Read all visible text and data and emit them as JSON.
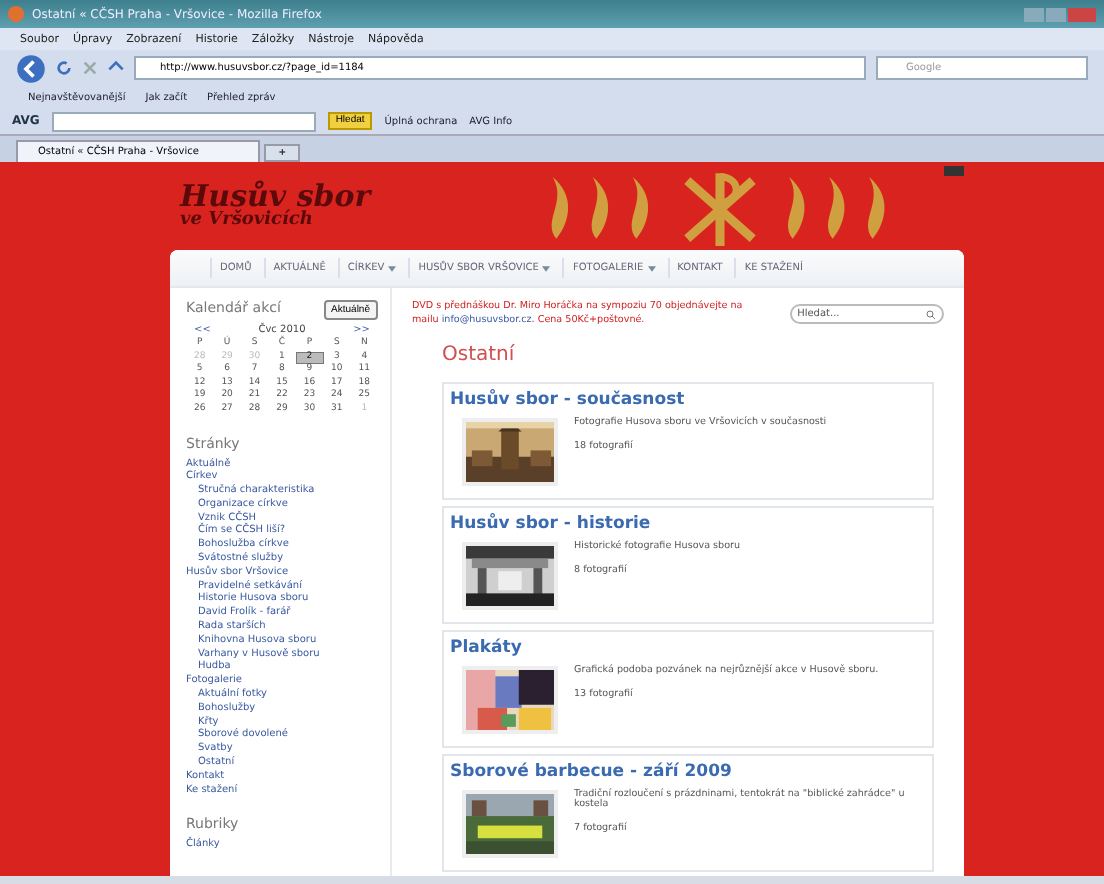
{
  "window": {
    "title": "Ostatní « CČSH Praha - Vršovice - Mozilla Firefox"
  },
  "menu": [
    "Soubor",
    "Úpravy",
    "Zobrazení",
    "Historie",
    "Záložky",
    "Nástroje",
    "Nápověda"
  ],
  "address": {
    "value": "http://www.husuvsbor.cz/?page_id=1184"
  },
  "browser_search": {
    "placeholder": "Google"
  },
  "bookmarks": [
    "Nejnavštěvovanější",
    "Jak začít",
    "Přehled zpráv"
  ],
  "avg_toolbar": {
    "logo": "AVG",
    "search_button": "Hledat",
    "items": [
      "Úplná ochrana",
      "AVG Info"
    ]
  },
  "tabs": [
    {
      "label": "Ostatní « CČSH Praha - Vršovice",
      "selected": true
    }
  ],
  "new_tab": "+",
  "site": {
    "title": "Husův sbor",
    "subtitle": "ve Vršovicích"
  },
  "nav": [
    {
      "label": "DOMŮ",
      "dropdown": false
    },
    {
      "label": "AKTUÁLNĚ",
      "dropdown": false
    },
    {
      "label": "CÍRKEV",
      "dropdown": true
    },
    {
      "label": "HUSŮV SBOR VRŠOVICE",
      "dropdown": true
    },
    {
      "label": "FOTOGALERIE",
      "dropdown": true
    },
    {
      "label": "KONTAKT",
      "dropdown": false
    },
    {
      "label": "KE STAŽENÍ",
      "dropdown": false
    }
  ],
  "calendar": {
    "title": "Kalendář akcí",
    "today_button": "Aktuálně",
    "prev": "<<",
    "month": "Čvc 2010",
    "next": ">>",
    "weekdays": [
      "P",
      "Ú",
      "S",
      "Č",
      "P",
      "S",
      "N"
    ],
    "weeks": [
      [
        {
          "day": "28",
          "other_month": true,
          "selected": false
        },
        {
          "day": "29",
          "other_month": true,
          "selected": false
        },
        {
          "day": "30",
          "other_month": true,
          "selected": false
        },
        {
          "day": "1",
          "other_month": false,
          "selected": false
        },
        {
          "day": "2",
          "other_month": false,
          "selected": true
        },
        {
          "day": "3",
          "other_month": false,
          "selected": false
        },
        {
          "day": "4",
          "other_month": false,
          "selected": false
        }
      ],
      [
        {
          "day": "5",
          "other_month": false,
          "selected": false
        },
        {
          "day": "6",
          "other_month": false,
          "selected": false
        },
        {
          "day": "7",
          "other_month": false,
          "selected": false
        },
        {
          "day": "8",
          "other_month": false,
          "selected": false
        },
        {
          "day": "9",
          "other_month": false,
          "selected": false
        },
        {
          "day": "10",
          "other_month": false,
          "selected": false
        },
        {
          "day": "11",
          "other_month": false,
          "selected": false
        }
      ],
      [
        {
          "day": "12",
          "other_month": false,
          "selected": false
        },
        {
          "day": "13",
          "other_month": false,
          "selected": false
        },
        {
          "day": "14",
          "other_month": false,
          "selected": false
        },
        {
          "day": "15",
          "other_month": false,
          "selected": false
        },
        {
          "day": "16",
          "other_month": false,
          "selected": false
        },
        {
          "day": "17",
          "other_month": false,
          "selected": false
        },
        {
          "day": "18",
          "other_month": false,
          "selected": false
        }
      ],
      [
        {
          "day": "19",
          "other_month": false,
          "selected": false
        },
        {
          "day": "20",
          "other_month": false,
          "selected": false
        },
        {
          "day": "21",
          "other_month": false,
          "selected": false
        },
        {
          "day": "22",
          "other_month": false,
          "selected": false
        },
        {
          "day": "23",
          "other_month": false,
          "selected": false
        },
        {
          "day": "24",
          "other_month": false,
          "selected": false
        },
        {
          "day": "25",
          "other_month": false,
          "selected": false
        }
      ],
      [
        {
          "day": "26",
          "other_month": false,
          "selected": false
        },
        {
          "day": "27",
          "other_month": false,
          "selected": false
        },
        {
          "day": "28",
          "other_month": false,
          "selected": false
        },
        {
          "day": "29",
          "other_month": false,
          "selected": false
        },
        {
          "day": "30",
          "other_month": false,
          "selected": false
        },
        {
          "day": "31",
          "other_month": false,
          "selected": false
        },
        {
          "day": "1",
          "other_month": true,
          "selected": false
        }
      ]
    ]
  },
  "pages": {
    "title": "Stránky",
    "items": [
      {
        "label": "Aktuálně"
      },
      {
        "label": "Církev",
        "children": [
          {
            "label": "Stručná charakteristika"
          },
          {
            "label": "Organizace církve"
          },
          {
            "label": "Vznik CČSH"
          },
          {
            "label": "Čím se CČSH liší?"
          },
          {
            "label": "Bohoslužba církve"
          },
          {
            "label": "Svátostné služby"
          }
        ]
      },
      {
        "label": "Husův sbor Vršovice",
        "children": [
          {
            "label": "Pravidelné setkávání"
          },
          {
            "label": "Historie Husova sboru"
          },
          {
            "label": "David Frolík - farář"
          },
          {
            "label": "Rada starších"
          },
          {
            "label": "Knihovna Husova sboru"
          },
          {
            "label": "Varhany v Husově sboru"
          },
          {
            "label": "Hudba"
          }
        ]
      },
      {
        "label": "Fotogalerie",
        "children": [
          {
            "label": "Aktuální fotky"
          },
          {
            "label": "Bohoslužby"
          },
          {
            "label": "Křty"
          },
          {
            "label": "Sborové dovolené"
          },
          {
            "label": "Svatby"
          },
          {
            "label": "Ostatní"
          }
        ]
      },
      {
        "label": "Kontakt"
      },
      {
        "label": "Ke stažení"
      }
    ]
  },
  "categories": {
    "title": "Rubriky",
    "items": [
      "Články"
    ]
  },
  "notice": {
    "text": "DVD s přednáškou Dr. Miro Horáčka na sympoziu 70 objednávejte na mailu",
    "link": "info@husuvsbor.cz",
    "after": ". Cena 50Kč+poštovné."
  },
  "search": {
    "placeholder": "Hledat..."
  },
  "page_title": "Ostatní",
  "galleries": [
    {
      "title": "Husův sbor - současnost",
      "description": "Fotografie Husova sboru ve Vršovicích v současnosti",
      "count": "18 fotografií"
    },
    {
      "title": "Husův sbor - historie",
      "description": "Historické fotografie Husova sboru",
      "count": "8 fotografií"
    },
    {
      "title": "Plakáty",
      "description": "Grafická podoba pozvánek na nejrůznější akce v Husově sboru.",
      "count": "13 fotografií"
    },
    {
      "title": "Sborové barbecue - září 2009",
      "description": "Tradiční rozloučení s prázdninami, tentokrát na \"biblické zahrádce\" u kostela",
      "count": "7 fotografií"
    }
  ]
}
